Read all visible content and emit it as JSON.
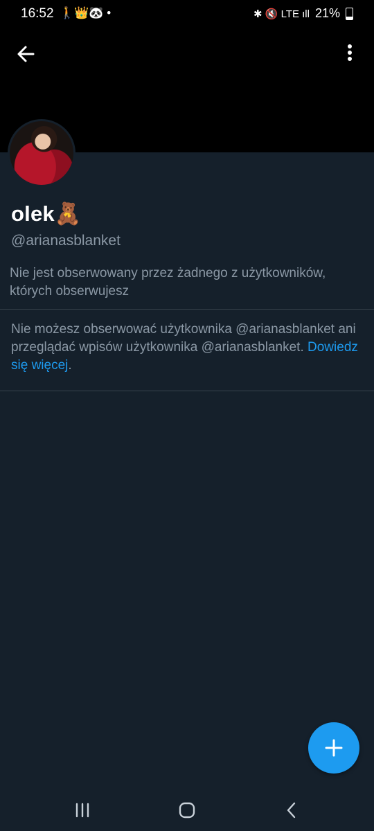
{
  "status": {
    "time": "16:52",
    "left_icons": "🚶👑🐼 •",
    "right_icons": "✱ 🔇 LTE ıll",
    "battery": "21%"
  },
  "icons": {
    "back": "arrow-left-icon",
    "more": "more-vertical-icon",
    "fab": "plus-icon",
    "nav_recent": "recent-apps-icon",
    "nav_home": "home-icon",
    "nav_back": "chevron-left-icon"
  },
  "profile": {
    "name": "olek🧸",
    "handle": "@arianasblanket",
    "followers_note": "Nie jest obserwowany przez żadnego z użytkowników, których obserwujesz"
  },
  "notice": {
    "text": "Nie możesz obserwować użytkownika @arianasblanket ani przeglądać wpisów użytkownika @arianasblanket. ",
    "link": "Dowiedz się więcej",
    "suffix": "."
  },
  "colors": {
    "background": "#15202b",
    "accent": "#1d9bf0",
    "secondary_text": "#8b98a5",
    "divider": "#38444d"
  }
}
